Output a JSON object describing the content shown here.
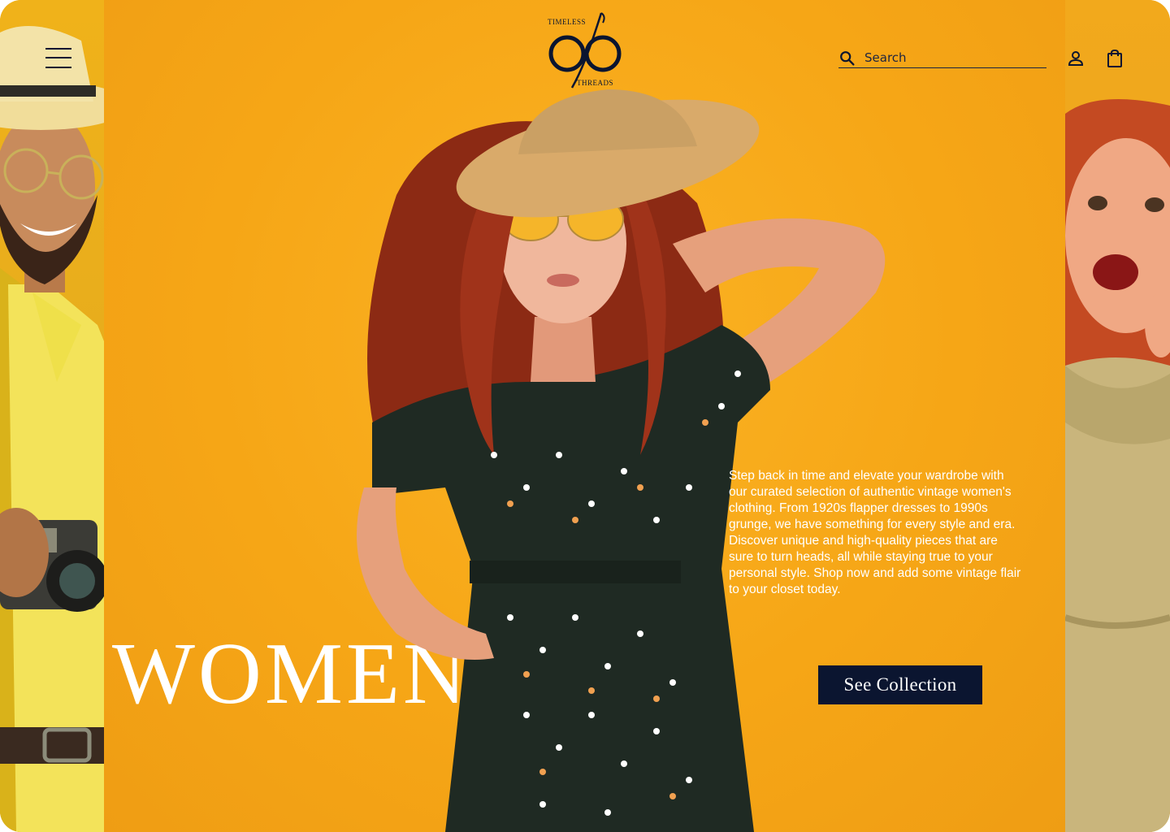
{
  "brand": {
    "logo_top": "TIMELESS",
    "logo_bottom": "THREADS"
  },
  "header": {
    "menu_icon": "hamburger-menu-icon",
    "search": {
      "placeholder": "Search",
      "icon": "search-icon"
    },
    "account_icon": "user-icon",
    "cart_icon": "shopping-bag-icon"
  },
  "hero": {
    "headline": "WOMEN",
    "description": "Step back in time and elevate your wardrobe with our curated selection of authentic vintage women's clothing. From 1920s flapper dresses to 1990s grunge, we have something for every style and era. Discover unique and high-quality pieces that are sure to turn heads, all while staying true to your personal style. Shop now and add some vintage flair to your closet today.",
    "cta_label": "See Collection"
  },
  "colors": {
    "background": "#f4a418",
    "navy": "#0b1530",
    "text_light": "#ffffff"
  }
}
